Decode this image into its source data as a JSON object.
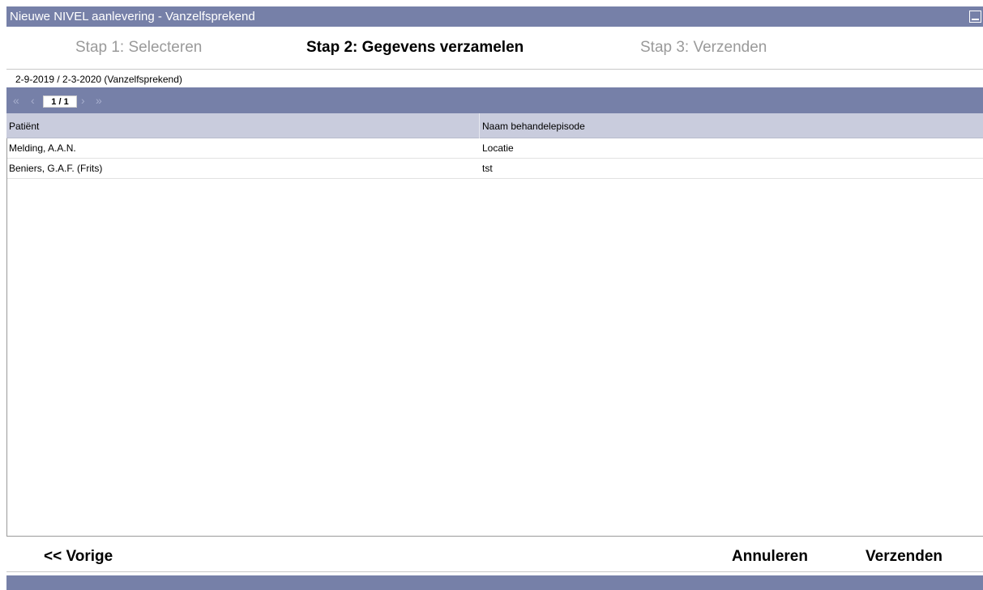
{
  "window": {
    "title": "Nieuwe NIVEL aanlevering - Vanzelfsprekend"
  },
  "steps": [
    {
      "label": "Stap 1: Selecteren",
      "state": "inactive"
    },
    {
      "label": "Stap 2: Gegevens verzamelen",
      "state": "active"
    },
    {
      "label": "Stap 3: Verzenden",
      "state": "inactive"
    }
  ],
  "period": {
    "label": "2-9-2019 / 2-3-2020 (Vanzelfsprekend)"
  },
  "pager": {
    "first_icon": "double-chevron-left-icon",
    "prev_icon": "chevron-left-icon",
    "next_icon": "chevron-right-icon",
    "last_icon": "double-chevron-right-icon",
    "first_glyph": "«",
    "prev_glyph": "‹",
    "next_glyph": "›",
    "last_glyph": "»",
    "page": "1 / 1"
  },
  "table": {
    "columns": [
      "Patiënt",
      "Naam behandelepisode"
    ],
    "rows": [
      [
        "Melding, A.A.N.",
        "Locatie"
      ],
      [
        "Beniers, G.A.F. (Frits)",
        "tst"
      ]
    ]
  },
  "footer": {
    "prev_label": "<< Vorige",
    "cancel_label": "Annuleren",
    "send_label": "Verzenden"
  },
  "colors": {
    "titlebar": "#7680a8",
    "header_row": "#c9ccdd",
    "inactive_step": "#9a9a9a"
  }
}
